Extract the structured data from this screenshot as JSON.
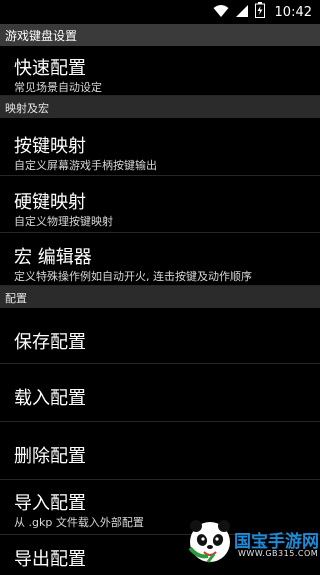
{
  "status": {
    "time": "10:42",
    "icons": [
      "wifi-icon",
      "signal-icon",
      "battery-icon"
    ]
  },
  "title": "游戏键盘设置",
  "sections": {
    "quick": {
      "items": [
        {
          "label": "快速配置",
          "sub": "常见场景自动设定"
        }
      ]
    },
    "mapping": {
      "header": "映射及宏",
      "items": [
        {
          "label": "按键映射",
          "sub": "自定义屏幕游戏手柄按键输出"
        },
        {
          "label": "硬键映射",
          "sub": "自定义物理按键映射"
        },
        {
          "label": "宏 编辑器",
          "sub": "定义特殊操作例如自动开火, 连击按键及动作顺序"
        }
      ]
    },
    "config": {
      "header": "配置",
      "items": [
        {
          "label": "保存配置"
        },
        {
          "label": "载入配置"
        },
        {
          "label": "删除配置"
        },
        {
          "label": "导入配置",
          "sub": "从 .gkp 文件载入外部配置"
        },
        {
          "label": "导出配置"
        }
      ]
    }
  },
  "watermark": {
    "brand": "国宝手游网",
    "site": "WWW.GB315.COM"
  }
}
